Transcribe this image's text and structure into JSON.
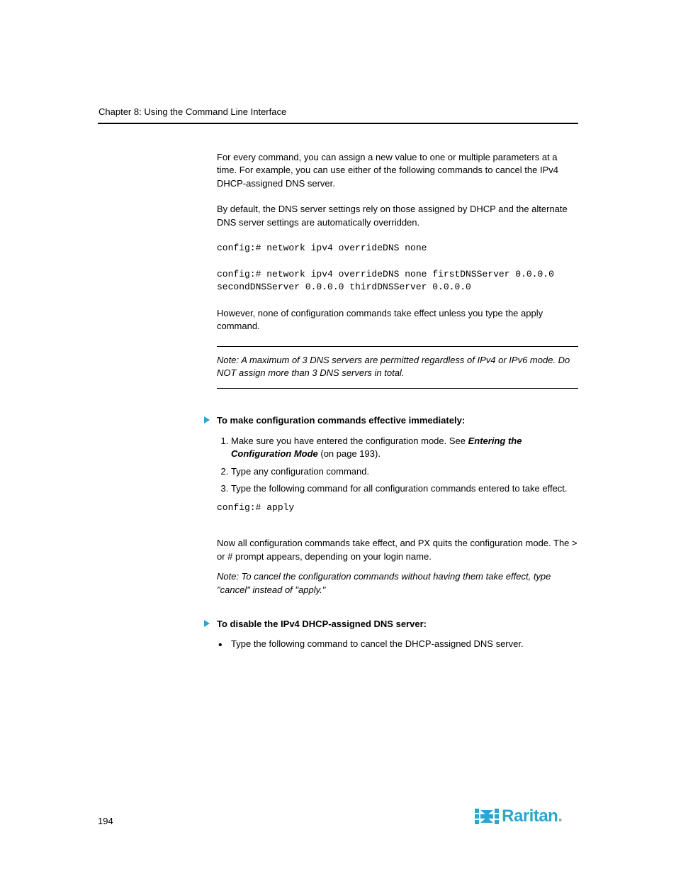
{
  "chapterLabel": "Chapter 8: Using the Command Line Interface",
  "paragraphs": {
    "p1": "For every command, you can assign a new value to one or multiple parameters at a time. For example, you can use either of the following commands to cancel the IPv4 DHCP-assigned DNS server.",
    "p2": "By default, the DNS server settings rely on those assigned by DHCP and the alternate DNS server settings are automatically overridden.",
    "cmd1": "config:# network ipv4 overrideDNS none",
    "cmd2": "config:# network ipv4 overrideDNS none firstDNSServer 0.0.0.0 secondDNSServer 0.0.0.0 thirdDNSServer 0.0.0.0",
    "p3": "However, none of configuration commands take effect unless you type the apply command.",
    "noteText": "Note: A maximum of 3 DNS servers are permitted regardless of IPv4 or IPv6 mode. Do NOT assign more than 3 DNS servers in total.",
    "procATitle": "To make configuration commands effective immediately:",
    "stepsA": [
      "Make sure you have entered the configuration mode. See ",
      " (on page 193).",
      "Type any configuration command.",
      "Type the following command for all configuration commands entered to take effect."
    ],
    "linkA": "Entering the Configuration Mode",
    "applyCmd": "config:#    apply",
    "closingPara": "Now all configuration commands take effect, and PX quits the configuration mode. The > or # prompt appears, depending on your login name.",
    "inlineNote": "Note: To cancel the configuration commands without having them take effect, type \"cancel\" instead of \"apply.\"",
    "procBTitle": "To disable the IPv4 DHCP-assigned DNS server:",
    "bulletB": "Type the following command to cancel the DHCP-assigned DNS server."
  },
  "pageNumber": "194",
  "brand": "Raritan"
}
